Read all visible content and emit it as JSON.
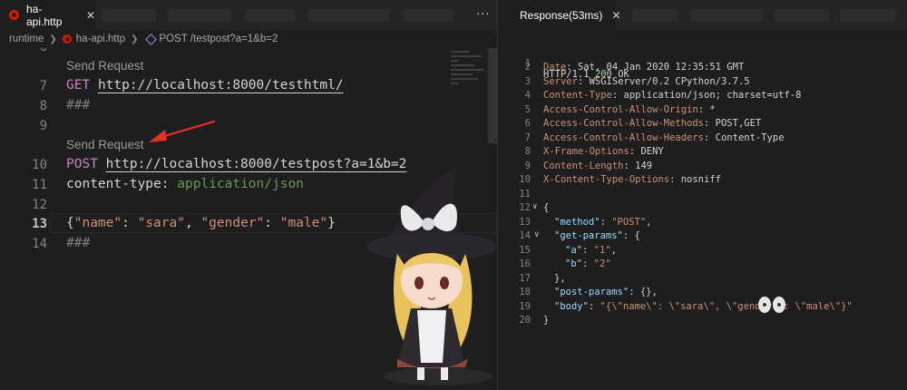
{
  "left_tab": {
    "title": "ha-api.http",
    "close": "✕"
  },
  "more_label": "···",
  "breadcrumb": {
    "folder": "runtime",
    "file": "ha-api.http",
    "request": "POST /testpost?a=1&b=2"
  },
  "editor": {
    "line_numbers": [
      "6",
      "7",
      "8",
      "9",
      "10",
      "11",
      "12",
      "13",
      "14"
    ],
    "codelens": [
      "Send Request",
      "Send Request"
    ],
    "line7": {
      "method": "GET",
      "url": "http://localhost:8000/testhtml/"
    },
    "line8": "###",
    "line10": {
      "method": "POST",
      "url": "http://localhost:8000/testpost?a=1&b=2"
    },
    "line11": {
      "header": "content-type",
      "colon": ": ",
      "value": "application/json"
    },
    "line13": {
      "open": "{",
      "k1": "\"name\"",
      "sep1": ": ",
      "v1": "\"sara\"",
      "comma": ", ",
      "k2": "\"gender\"",
      "sep2": ": ",
      "v2": "\"male\"",
      "close": "}"
    },
    "line14": "###"
  },
  "right_tab": {
    "title": "Response(53ms)",
    "close": "✕"
  },
  "response": {
    "line_numbers": [
      "1",
      "2",
      "3",
      "4",
      "5",
      "6",
      "7",
      "8",
      "9",
      "10",
      "11",
      "12",
      "13",
      "14",
      "15",
      "16",
      "17",
      "18",
      "19",
      "20"
    ],
    "status_line": {
      "protocol": "HTTP/1.1 ",
      "code": "200",
      "text": " OK"
    },
    "headers": [
      {
        "name": "Date",
        "value": ": Sat, 04 Jan 2020 12:35:51 GMT"
      },
      {
        "name": "Server",
        "value": ": WSGIServer/0.2 CPython/3.7.5"
      },
      {
        "name": "Content-Type",
        "value": ": application/json; charset=utf-8"
      },
      {
        "name": "Access-Control-Allow-Origin",
        "value": ": *"
      },
      {
        "name": "Access-Control-Allow-Methods",
        "value": ": POST,GET"
      },
      {
        "name": "Access-Control-Allow-Headers",
        "value": ": Content-Type"
      },
      {
        "name": "X-Frame-Options",
        "value": ": DENY"
      },
      {
        "name": "Content-Length",
        "value": ": 149"
      },
      {
        "name": "X-Content-Type-Options",
        "value": ": nosniff"
      }
    ],
    "body": {
      "open": "{",
      "method_key": "\"method\"",
      "method_val": "\"POST\"",
      "get_key": "\"get-params\"",
      "get_open": ": {",
      "a_key": "\"a\"",
      "a_val": "\"1\"",
      "b_key": "\"b\"",
      "b_val": "\"2\"",
      "get_close": "},",
      "post_key": "\"post-params\"",
      "post_val": ": {},",
      "body_key": "\"body\"",
      "body_val": "\"{\\\"name\\\": \\\"sara\\\", \\\"gender\\\": \\\"male\\\"}\"",
      "close": "}"
    }
  },
  "colors": {
    "keyword": "#c586c0",
    "string": "#ce9178",
    "json_key": "#9cdcfe",
    "comment": "#6a9955",
    "annotation_arrow": "#e8302a"
  }
}
